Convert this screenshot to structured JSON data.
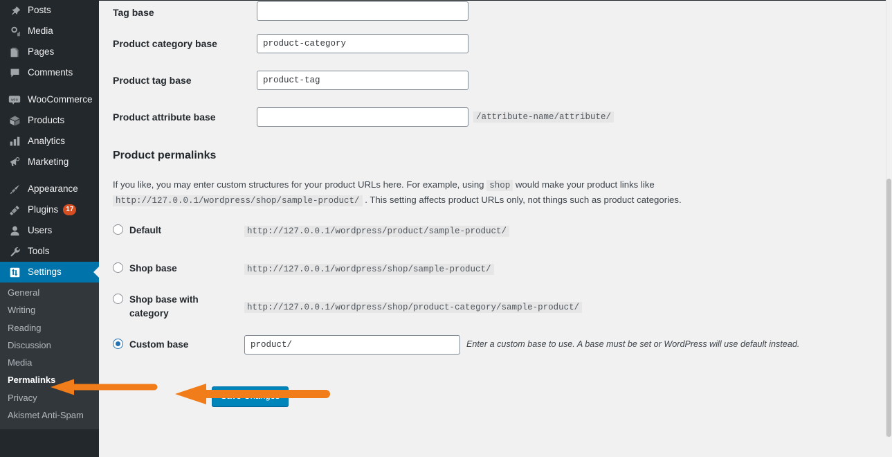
{
  "sidebar": {
    "menu": [
      {
        "label": "Posts",
        "icon": "pin-icon",
        "active": false
      },
      {
        "label": "Media",
        "icon": "media-icon",
        "active": false
      },
      {
        "label": "Pages",
        "icon": "pages-icon",
        "active": false
      },
      {
        "label": "Comments",
        "icon": "comment-icon",
        "active": false
      },
      {
        "label": "WooCommerce",
        "icon": "woocommerce-icon",
        "active": false
      },
      {
        "label": "Products",
        "icon": "box-icon",
        "active": false
      },
      {
        "label": "Analytics",
        "icon": "bar-chart-icon",
        "active": false
      },
      {
        "label": "Marketing",
        "icon": "megaphone-icon",
        "active": false
      },
      {
        "label": "Appearance",
        "icon": "paintbrush-icon",
        "active": false
      },
      {
        "label": "Plugins",
        "icon": "plug-icon",
        "active": false,
        "badge": "17"
      },
      {
        "label": "Users",
        "icon": "user-icon",
        "active": false
      },
      {
        "label": "Tools",
        "icon": "wrench-icon",
        "active": false
      },
      {
        "label": "Settings",
        "icon": "settings-icon",
        "active": true
      }
    ],
    "submenu": [
      {
        "label": "General",
        "current": false
      },
      {
        "label": "Writing",
        "current": false
      },
      {
        "label": "Reading",
        "current": false
      },
      {
        "label": "Discussion",
        "current": false
      },
      {
        "label": "Media",
        "current": false
      },
      {
        "label": "Permalinks",
        "current": true
      },
      {
        "label": "Privacy",
        "current": false
      },
      {
        "label": "Akismet Anti-Spam",
        "current": false
      }
    ]
  },
  "form": {
    "rows": [
      {
        "label": "Tag base",
        "value": "",
        "placeholder": "",
        "hint": ""
      },
      {
        "label": "Product category base",
        "value": "product-category",
        "placeholder": "",
        "hint": ""
      },
      {
        "label": "Product tag base",
        "value": "product-tag",
        "placeholder": "",
        "hint": ""
      },
      {
        "label": "Product attribute base",
        "value": "",
        "placeholder": "",
        "hint": "/attribute-name/attribute/"
      }
    ]
  },
  "permalinks": {
    "heading": "Product permalinks",
    "desc_part1": "If you like, you may enter custom structures for your product URLs here. For example, using",
    "desc_code1": "shop",
    "desc_part2": "would make your product links like",
    "desc_code2": "http://127.0.0.1/wordpress/shop/sample-product/",
    "desc_part3": ". This setting affects product URLs only, not things such as product categories.",
    "options": [
      {
        "label": "Default",
        "url": "http://127.0.0.1/wordpress/product/sample-product/",
        "checked": false
      },
      {
        "label": "Shop base",
        "url": "http://127.0.0.1/wordpress/shop/sample-product/",
        "checked": false
      },
      {
        "label": "Shop base with category",
        "url": "http://127.0.0.1/wordpress/shop/product-category/sample-product/",
        "checked": false
      },
      {
        "label": "Custom base",
        "url": "",
        "checked": true,
        "input_value": "product/",
        "hint": "Enter a custom base to use. A base must be set or WordPress will use default instead."
      }
    ]
  },
  "actions": {
    "save_label": "Save Changes"
  },
  "colors": {
    "sidebar_bg": "#23282d",
    "submenu_bg": "#32373c",
    "active_blue": "#0073aa",
    "button_blue": "#0085ba",
    "annotation_orange": "#f07d1a",
    "badge_orange": "#d54e21"
  }
}
